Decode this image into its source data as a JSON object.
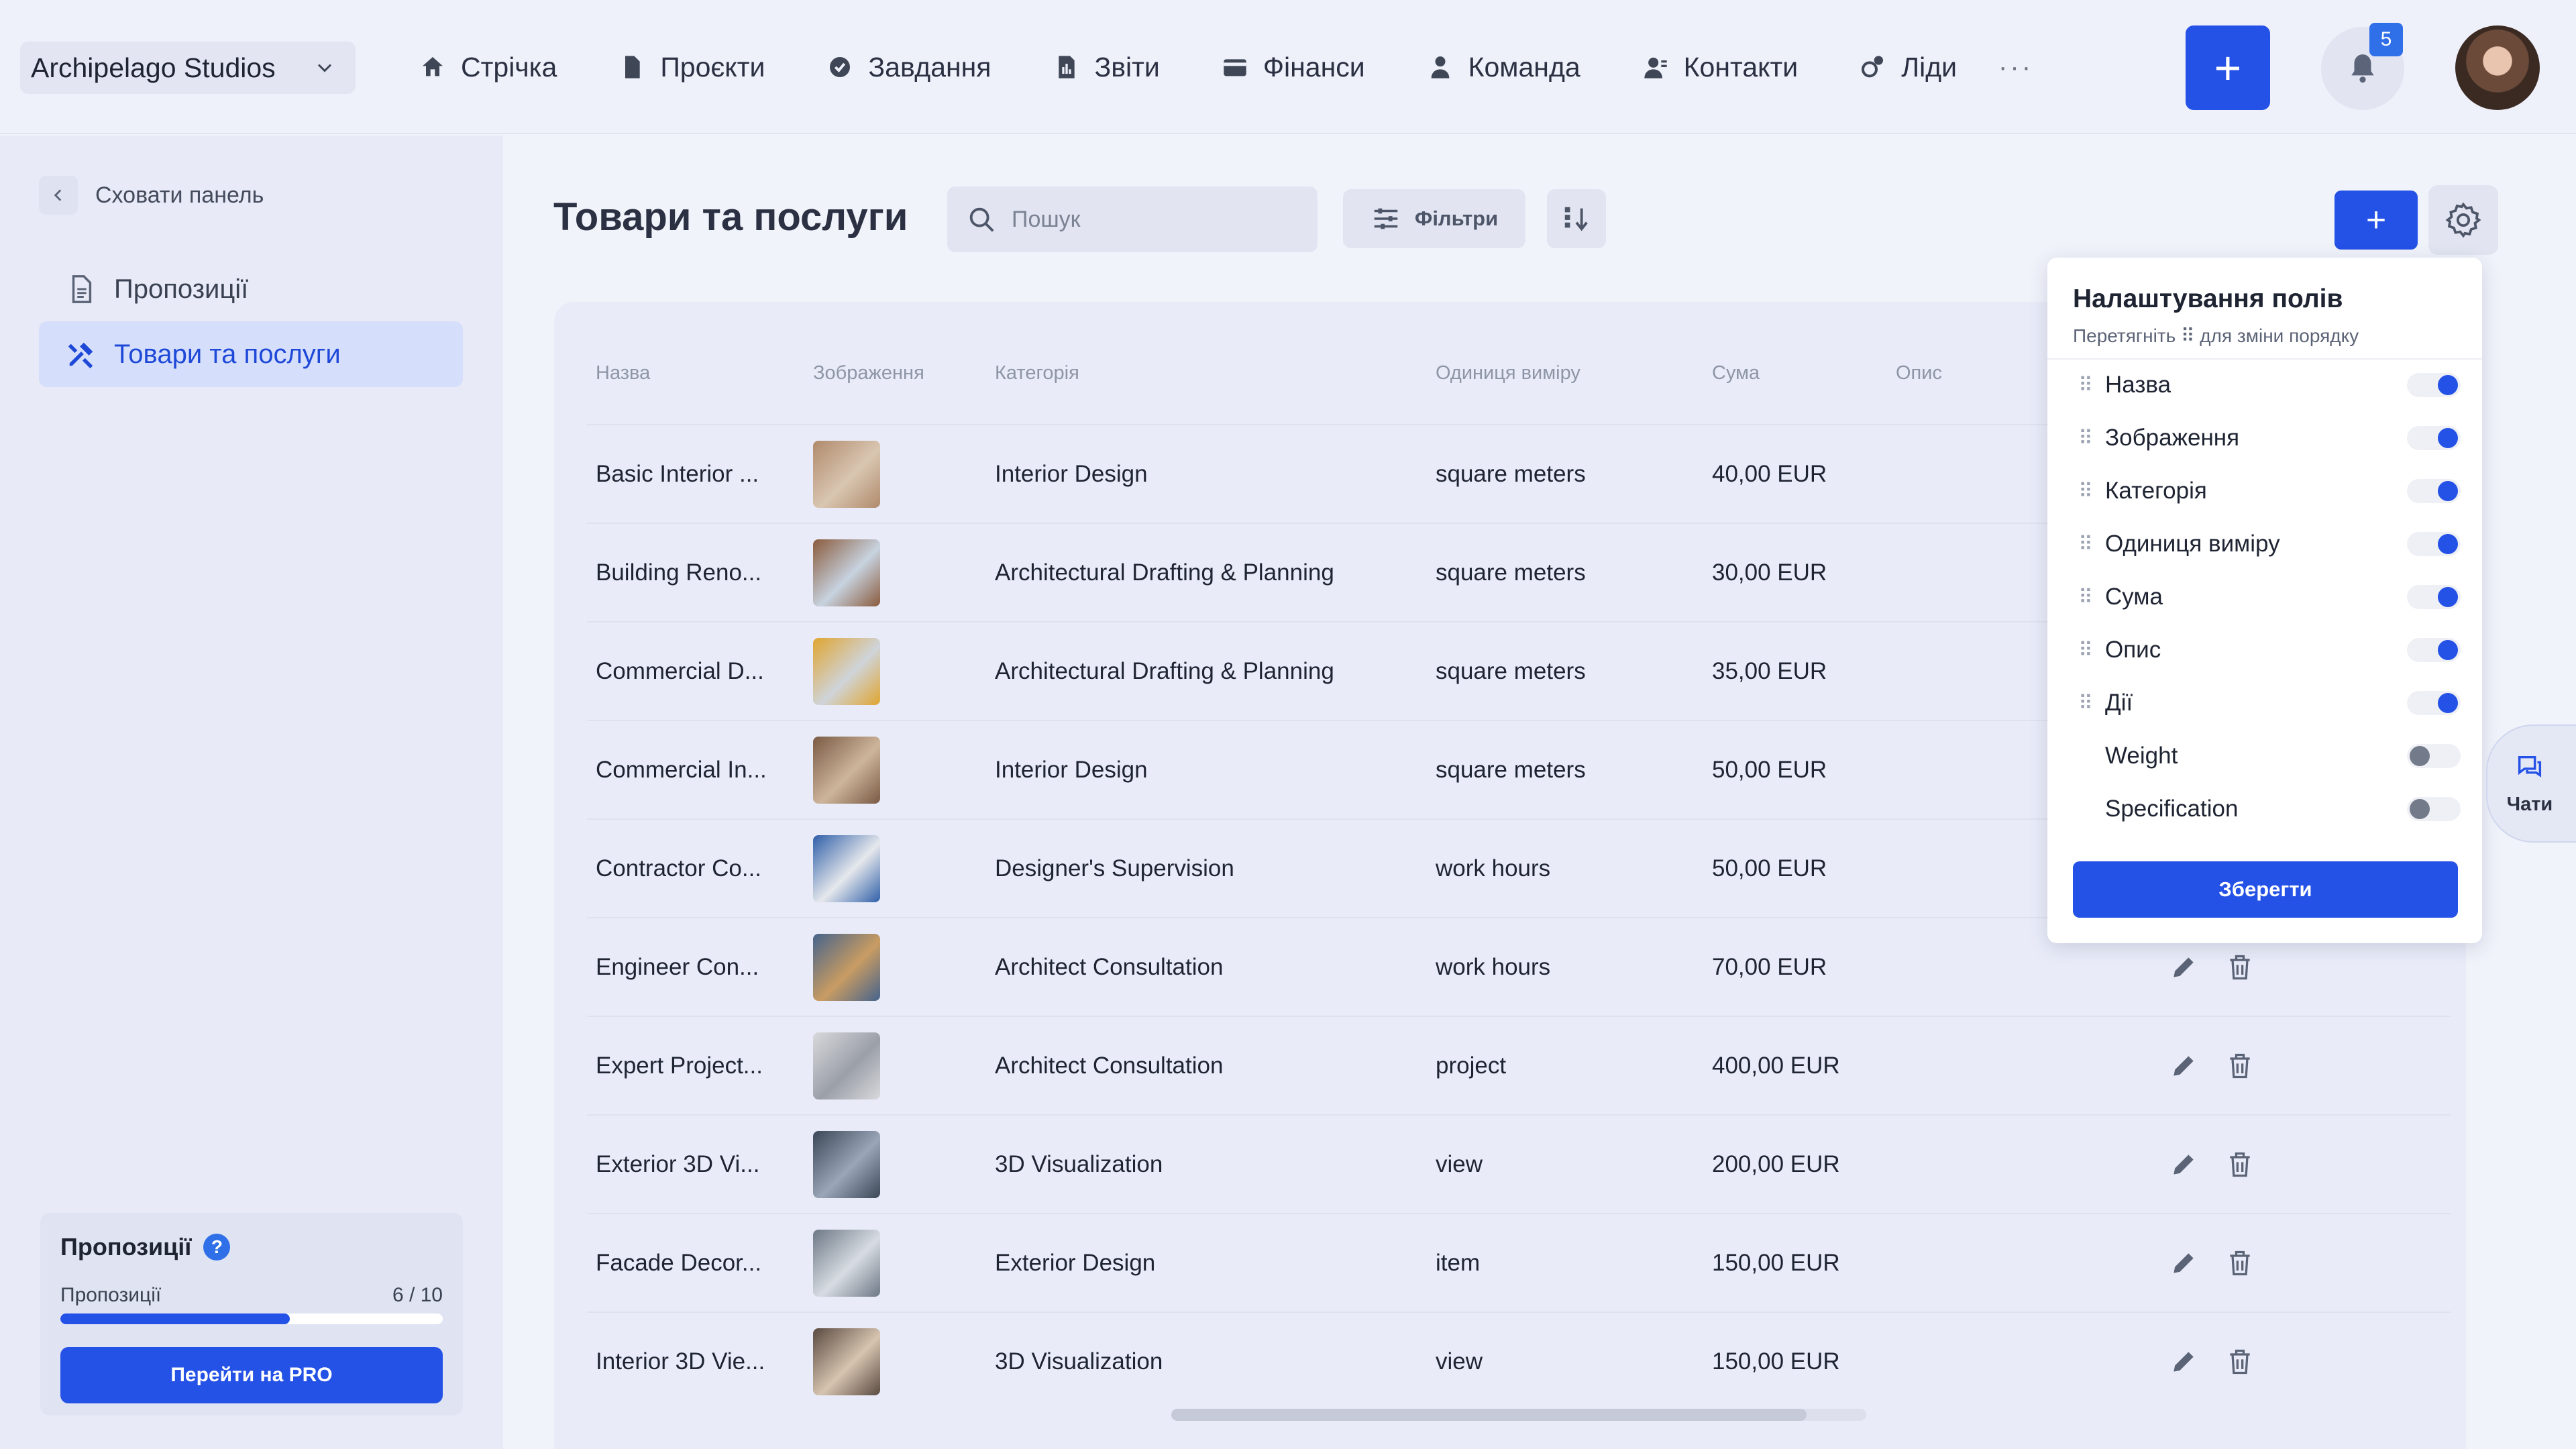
{
  "topbar": {
    "org_name": "Archipelago Studios",
    "nav": [
      {
        "label": "Стрічка",
        "icon": "home-icon"
      },
      {
        "label": "Проєкти",
        "icon": "document-icon"
      },
      {
        "label": "Завдання",
        "icon": "check-circle-icon"
      },
      {
        "label": "Звіти",
        "icon": "report-icon"
      },
      {
        "label": "Фінанси",
        "icon": "wallet-icon"
      },
      {
        "label": "Команда",
        "icon": "person-icon"
      },
      {
        "label": "Контакти",
        "icon": "contacts-icon"
      },
      {
        "label": "Ліди",
        "icon": "leads-icon"
      }
    ],
    "more": "···",
    "add_label": "+",
    "notification_count": "5"
  },
  "sidebar": {
    "hide_label": "Сховати панель",
    "items": [
      {
        "label": "Пропозиції",
        "icon": "document-icon",
        "active": false
      },
      {
        "label": "Товари та послуги",
        "icon": "tools-icon",
        "active": true
      }
    ],
    "promo": {
      "title": "Пропозиції",
      "help": "?",
      "counter_label": "Пропозиції",
      "counter_value": "6 / 10",
      "progress": 0.6,
      "button_label": "Перейти на PRO"
    }
  },
  "main": {
    "title": "Товари та послуги",
    "search_placeholder": "Пошук",
    "filters_label": "Фільтри",
    "add_label": "+"
  },
  "table": {
    "headers": [
      "Назва",
      "Зображення",
      "Категорія",
      "Одиниця виміру",
      "Сума",
      "Опис"
    ],
    "rows": [
      {
        "name": "Basic Interior ...",
        "category": "Interior Design",
        "unit": "square meters",
        "amount": "40,00 EUR",
        "img": [
          "#b08a6c",
          "#d9c6b1"
        ]
      },
      {
        "name": "Building Reno...",
        "category": "Architectural Drafting & Planning",
        "unit": "square meters",
        "amount": "30,00 EUR",
        "img": [
          "#8a5a3c",
          "#c7d3e0"
        ]
      },
      {
        "name": "Commercial D...",
        "category": "Architectural Drafting & Planning",
        "unit": "square meters",
        "amount": "35,00 EUR",
        "img": [
          "#e0a530",
          "#cfd4da"
        ]
      },
      {
        "name": "Commercial In...",
        "category": "Interior Design",
        "unit": "square meters",
        "amount": "50,00 EUR",
        "img": [
          "#7a5a44",
          "#cdb59b"
        ]
      },
      {
        "name": "Contractor Co...",
        "category": "Designer's Supervision",
        "unit": "work hours",
        "amount": "50,00 EUR",
        "img": [
          "#2f5fa8",
          "#e6e8ec"
        ]
      },
      {
        "name": "Engineer Con...",
        "category": "Architect Consultation",
        "unit": "work hours",
        "amount": "70,00 EUR",
        "img": [
          "#45638c",
          "#c99c62"
        ]
      },
      {
        "name": "Expert Project...",
        "category": "Architect Consultation",
        "unit": "project",
        "amount": "400,00 EUR",
        "img": [
          "#d8d9dc",
          "#9b9fa8"
        ]
      },
      {
        "name": "Exterior 3D Vi...",
        "category": "3D Visualization",
        "unit": "view",
        "amount": "200,00 EUR",
        "img": [
          "#3b4656",
          "#9aa6b8"
        ]
      },
      {
        "name": "Facade Decor...",
        "category": "Exterior Design",
        "unit": "item",
        "amount": "150,00 EUR",
        "img": [
          "#6d7885",
          "#d7dce2"
        ]
      },
      {
        "name": "Interior 3D Vie...",
        "category": "3D Visualization",
        "unit": "view",
        "amount": "150,00 EUR",
        "img": [
          "#5a4a40",
          "#d6c4b0"
        ]
      }
    ]
  },
  "field_settings": {
    "title": "Налаштування полів",
    "subtitle": "Перетягніть ⠿ для зміни порядку",
    "fields": [
      {
        "label": "Назва",
        "enabled": true,
        "draggable": true
      },
      {
        "label": "Зображення",
        "enabled": true,
        "draggable": true
      },
      {
        "label": "Категорія",
        "enabled": true,
        "draggable": true
      },
      {
        "label": "Одиниця виміру",
        "enabled": true,
        "draggable": true
      },
      {
        "label": "Сума",
        "enabled": true,
        "draggable": true
      },
      {
        "label": "Опис",
        "enabled": true,
        "draggable": true
      },
      {
        "label": "Дії",
        "enabled": true,
        "draggable": true
      },
      {
        "label": "Weight",
        "enabled": false,
        "draggable": false
      },
      {
        "label": "Specification",
        "enabled": false,
        "draggable": false
      }
    ],
    "save_label": "Зберегти"
  },
  "chats": {
    "label": "Чати"
  },
  "colors": {
    "accent": "#2451e6",
    "background": "#f1f3fb",
    "sidebar": "#e8ebf7"
  }
}
